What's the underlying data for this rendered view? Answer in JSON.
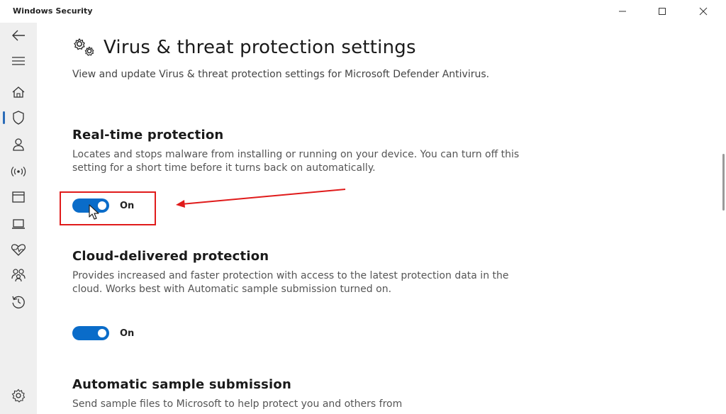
{
  "window": {
    "title": "Windows Security"
  },
  "rail": {
    "items": [
      {
        "icon": "back-arrow-icon",
        "selected": false
      },
      {
        "icon": "hamburger-menu-icon",
        "selected": false
      },
      {
        "icon": "home-icon",
        "selected": false
      },
      {
        "icon": "shield-icon",
        "selected": true
      },
      {
        "icon": "person-icon",
        "selected": false
      },
      {
        "icon": "network-icon",
        "selected": false
      },
      {
        "icon": "app-browser-icon",
        "selected": false
      },
      {
        "icon": "laptop-icon",
        "selected": false
      },
      {
        "icon": "heart-pulse-icon",
        "selected": false
      },
      {
        "icon": "family-icon",
        "selected": false
      },
      {
        "icon": "history-icon",
        "selected": false
      },
      {
        "icon": "settings-gear-icon",
        "selected": false
      }
    ],
    "accent": "#2b6cb8"
  },
  "page": {
    "title": "Virus & threat protection settings",
    "description": "View and update Virus & threat protection settings for Microsoft Defender Antivirus."
  },
  "sections": {
    "realtime": {
      "title": "Real-time protection",
      "description": "Locates and stops malware from installing or running on your device. You can turn off this setting for a short time before it turns back on automatically.",
      "toggle_state": "On"
    },
    "cloud": {
      "title": "Cloud-delivered protection",
      "description": "Provides increased and faster protection with access to the latest protection data in the cloud. Works best with Automatic sample submission turned on.",
      "toggle_state": "On"
    },
    "sample": {
      "title": "Automatic sample submission",
      "description": "Send sample files to Microsoft to help protect you and others from"
    }
  },
  "colors": {
    "toggle_on": "#0a6cc9",
    "annotation": "#e01b1b"
  }
}
